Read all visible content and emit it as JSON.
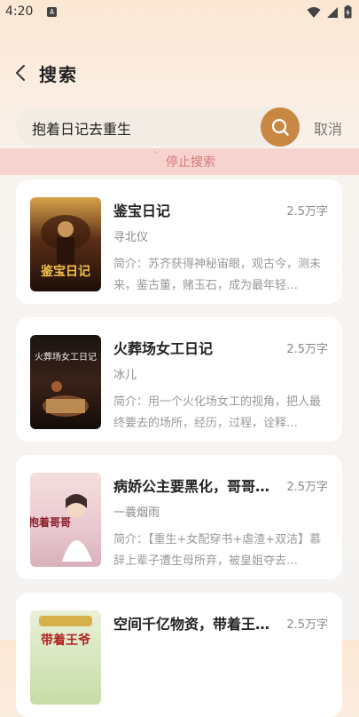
{
  "status_bar": {
    "time": "4:20",
    "badge": "A"
  },
  "header": {
    "title": "搜索"
  },
  "search": {
    "query": "抱着日记去重生",
    "cancel_label": "取消"
  },
  "stop_bar": {
    "label": "停止搜索"
  },
  "books": [
    {
      "title": "鉴宝日记",
      "words": "2.5万字",
      "author": "寻北仪",
      "intro": "简介：苏齐获得神秘宙眼，观古今，测未来，鉴古董，赌玉石，成为最年轻…",
      "cover_text": "鉴宝日记"
    },
    {
      "title": "火葬场女工日记",
      "words": "2.5万字",
      "author": "冰儿",
      "intro": "简介：用一个火化场女工的视角，把人最终要去的场所，经历，过程，诠释…",
      "cover_text": "火葬场女工日记"
    },
    {
      "title": "病娇公主要黑化，哥哥…",
      "words": "2.5万字",
      "author": "一蓑烟雨",
      "intro": "简介：【重生+女配穿书+虐渣+双洁】慕辞上辈子遭生母所弃，被皇姐夺去…",
      "cover_text": "抱着哥哥"
    },
    {
      "title": "空间千亿物资，带着王…",
      "words": "2.5万字",
      "author": "",
      "intro": "",
      "cover_text": "带着王爷"
    }
  ]
}
